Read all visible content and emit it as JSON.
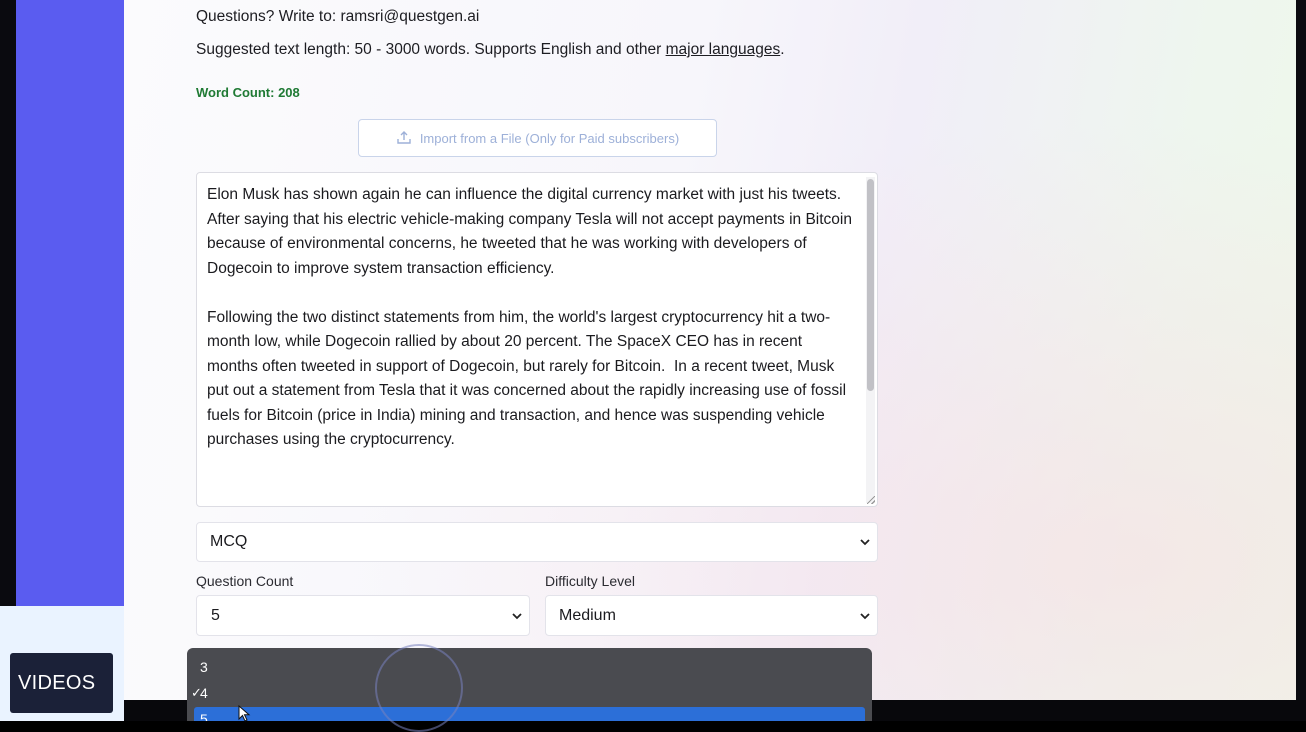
{
  "header": {
    "contact_text": "Questions? Write to: ramsri@questgen.ai",
    "suggested_text_prefix": "Suggested text length: 50 - 3000 words. Supports English and other ",
    "suggested_text_link": "major languages",
    "suggested_text_suffix": "."
  },
  "word_count": "Word Count: 208",
  "import_button": {
    "label": "Import from a File (Only for Paid subscribers)",
    "icon": "upload-icon"
  },
  "textarea": {
    "value": "Elon Musk has shown again he can influence the digital currency market with just his tweets. After saying that his electric vehicle-making company Tesla will not accept payments in Bitcoin because of environmental concerns, he tweeted that he was working with developers of Dogecoin to improve system transaction efficiency.\n\nFollowing the two distinct statements from him, the world's largest cryptocurrency hit a two-month low, while Dogecoin rallied by about 20 percent. The SpaceX CEO has in recent months often tweeted in support of Dogecoin, but rarely for Bitcoin.  In a recent tweet, Musk put out a statement from Tesla that it was concerned about the rapidly increasing use of fossil fuels for Bitcoin (price in India) mining and transaction, and hence was suspending vehicle purchases using the cryptocurrency."
  },
  "question_type_select": {
    "selected": "MCQ"
  },
  "question_count": {
    "label": "Question Count",
    "selected": "5"
  },
  "difficulty": {
    "label": "Difficulty Level",
    "selected": "Medium"
  },
  "count_dropdown": {
    "options": [
      {
        "label": "3",
        "checked": false
      },
      {
        "label": "4",
        "checked": true
      },
      {
        "label": "5",
        "checked": false,
        "highlighted": true
      }
    ],
    "checkmark": "✓"
  },
  "videos_button": {
    "label": "VIDEOS"
  },
  "colors": {
    "accent_purple": "#5a5cf0",
    "word_count_green": "#1f7a34",
    "dropdown_bg": "#4a4b50",
    "highlight_blue": "#2c6fd8"
  }
}
